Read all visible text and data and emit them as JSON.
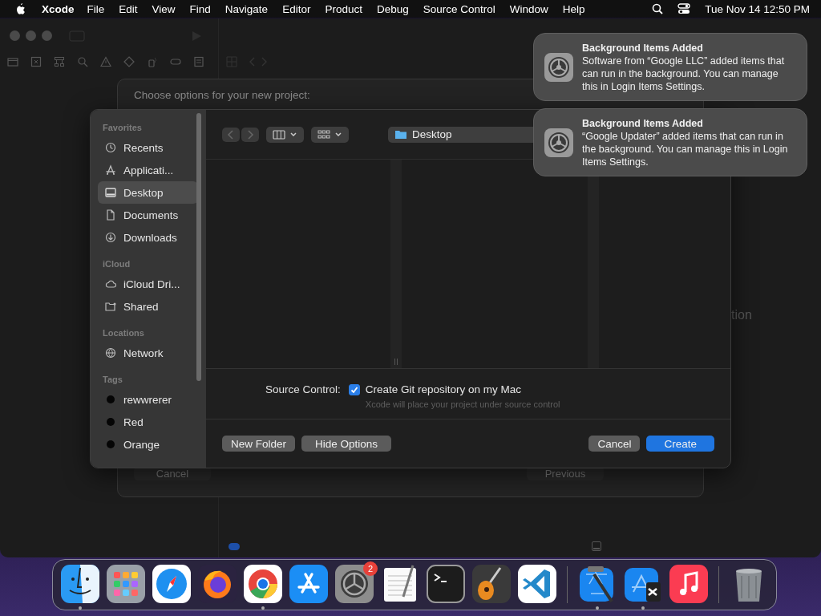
{
  "menu_bar": {
    "app": "Xcode",
    "items": [
      "File",
      "Edit",
      "View",
      "Find",
      "Navigate",
      "Editor",
      "Product",
      "Debug",
      "Source Control",
      "Window",
      "Help"
    ],
    "clock": "Tue Nov 14  12:50 PM"
  },
  "background_sheet": {
    "title": "Choose options for your new project:",
    "buttons": [
      "Cancel",
      "Previous"
    ],
    "partial_text": "tion"
  },
  "save_panel": {
    "sidebar": [
      {
        "heading": "Favorites",
        "items": [
          {
            "label": "Recents",
            "selected": false
          },
          {
            "label": "Applicati...",
            "selected": false
          },
          {
            "label": "Desktop",
            "selected": true
          },
          {
            "label": "Documents",
            "selected": false
          },
          {
            "label": "Downloads",
            "selected": false
          }
        ]
      },
      {
        "heading": "iCloud",
        "items": [
          {
            "label": "iCloud Dri...",
            "selected": false
          },
          {
            "label": "Shared",
            "selected": false
          }
        ]
      },
      {
        "heading": "Locations",
        "items": [
          {
            "label": "Network",
            "selected": false
          }
        ]
      },
      {
        "heading": "Tags",
        "items": [
          {
            "label": "rewwrerer",
            "selected": false
          },
          {
            "label": "Red",
            "selected": false
          },
          {
            "label": "Orange",
            "selected": false
          }
        ]
      }
    ],
    "location": "Desktop",
    "source_control": {
      "label": "Source Control:",
      "checkbox_label": "Create Git repository on my Mac",
      "checked": true,
      "hint": "Xcode will place your project under source control"
    },
    "buttons": [
      {
        "label": "New Folder",
        "kind": "secondary"
      },
      {
        "label": "Hide Options",
        "kind": "secondary"
      },
      {
        "label": "Cancel",
        "kind": "secondary"
      },
      {
        "label": "Create",
        "kind": "primary"
      }
    ]
  },
  "notifications": [
    {
      "title": "Background Items Added",
      "body": "Software from “Google LLC” added items that can run in the background. You can manage this in Login Items Settings."
    },
    {
      "title": "Background Items Added",
      "body": "“Google Updater” added items that can run in the background. You can manage this in Login Items Settings."
    }
  ],
  "dock": {
    "items": [
      {
        "kind": "app",
        "running": true
      },
      {
        "kind": "app",
        "running": false
      },
      {
        "kind": "app",
        "running": false
      },
      {
        "kind": "app",
        "running": false
      },
      {
        "kind": "app",
        "running": true
      },
      {
        "kind": "app",
        "running": false
      },
      {
        "kind": "app",
        "running": false,
        "badge": "2"
      },
      {
        "kind": "app",
        "running": false
      },
      {
        "kind": "app",
        "running": false
      },
      {
        "kind": "app",
        "running": false
      },
      {
        "kind": "app",
        "running": false
      },
      {
        "kind": "separator"
      },
      {
        "kind": "app",
        "running": true
      },
      {
        "kind": "app",
        "running": true
      },
      {
        "kind": "app",
        "running": false
      },
      {
        "kind": "separator"
      },
      {
        "kind": "app",
        "running": false
      }
    ]
  }
}
